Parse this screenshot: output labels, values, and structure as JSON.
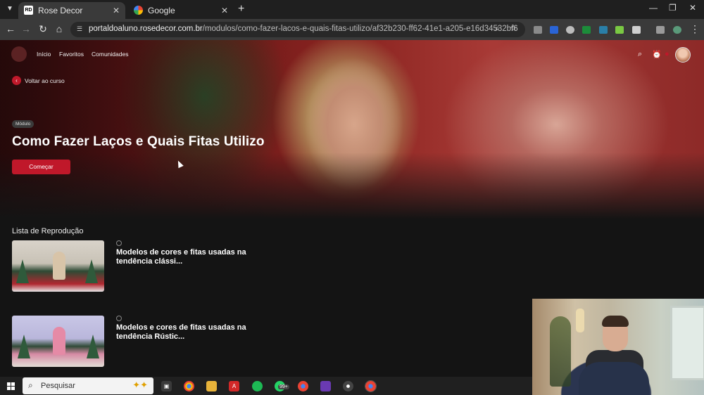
{
  "browser": {
    "tabs": [
      {
        "title": "Rose Decor",
        "favicon": "RD",
        "active": true
      },
      {
        "title": "Google",
        "favicon": "google-icon",
        "active": false
      }
    ],
    "url_domain": "portaldoaluno.rosedecor.com.br",
    "url_path": "/modulos/como-fazer-lacos-e-quais-fitas-utilizo/af32b230-ff62-41e1-a205-e16d34532bf6"
  },
  "site": {
    "nav": [
      "Início",
      "Favoritos",
      "Comunidades"
    ],
    "back_label": "Voltar ao curso",
    "badge": "Módulo",
    "title": "Como Fazer Laços e Quais Fitas Utilizo",
    "start_label": "Começar",
    "accent": "#c0182a"
  },
  "playlist": {
    "heading": "Lista de Reprodução",
    "items": [
      {
        "line1": "Modelos de cores e fitas usadas na",
        "line2": "tendência clássi..."
      },
      {
        "line1": "Modelos e cores de fitas usadas na",
        "line2": "tendência Rústic..."
      }
    ]
  },
  "taskbar": {
    "search_placeholder": "Pesquisar",
    "badge": "99+"
  }
}
